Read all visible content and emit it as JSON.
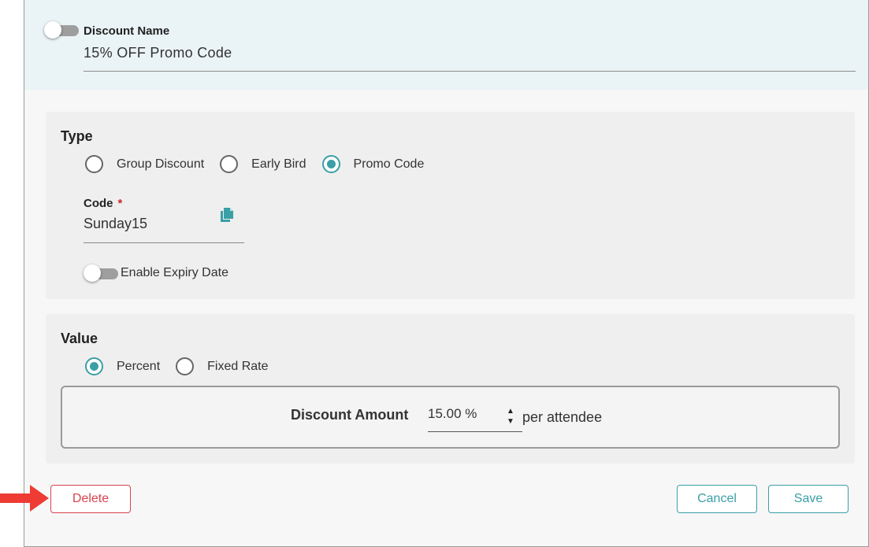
{
  "header": {
    "toggle_state": "off",
    "label": "Discount Name",
    "value": "15% OFF Promo Code"
  },
  "type_section": {
    "title": "Type",
    "options": [
      {
        "label": "Group Discount",
        "checked": false
      },
      {
        "label": "Early Bird",
        "checked": false
      },
      {
        "label": "Promo Code",
        "checked": true
      }
    ],
    "code": {
      "label": "Code",
      "required_mark": "*",
      "value": "Sunday15",
      "copy_icon": "copy-icon"
    },
    "expiry": {
      "toggle_state": "off",
      "label": "Enable Expiry Date"
    }
  },
  "value_section": {
    "title": "Value",
    "options": [
      {
        "label": "Percent",
        "checked": true
      },
      {
        "label": "Fixed Rate",
        "checked": false
      }
    ],
    "amount": {
      "label": "Discount Amount",
      "value": "15.00 %",
      "suffix": "per attendee",
      "spinner_up": "▲",
      "spinner_down": "▼"
    }
  },
  "actions": {
    "delete_label": "Delete",
    "cancel_label": "Cancel",
    "save_label": "Save"
  },
  "annotation": {
    "arrow_icon": "red-arrow-icon"
  },
  "colors": {
    "accent": "#3a9fa6",
    "danger": "#d9434f",
    "header_bg": "#eaf3f6",
    "card_bg": "#efefef",
    "arrow": "#ee3b34"
  }
}
